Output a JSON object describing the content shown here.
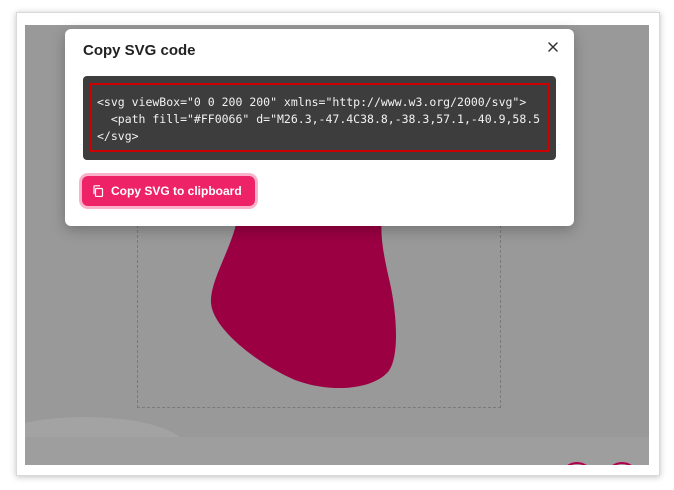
{
  "modal": {
    "title": "Copy SVG code",
    "close_icon": "close-icon",
    "code_lines": [
      "<svg viewBox=\"0 0 200 200\" xmlns=\"http://www.w3.org/2000/svg\">",
      "  <path fill=\"#FF0066\" d=\"M26.3,-47.4C38.8,-38.3,57.1,-40.9,58.5",
      "</svg>"
    ],
    "copy_button_label": "Copy SVG to clipboard",
    "copy_button_icon": "copy-icon"
  },
  "colors": {
    "backdrop": "#999999",
    "blob": "#9b0042",
    "accent": "#ee2266",
    "code_background": "#3d3d3d",
    "highlight_border": "#cc0000"
  }
}
